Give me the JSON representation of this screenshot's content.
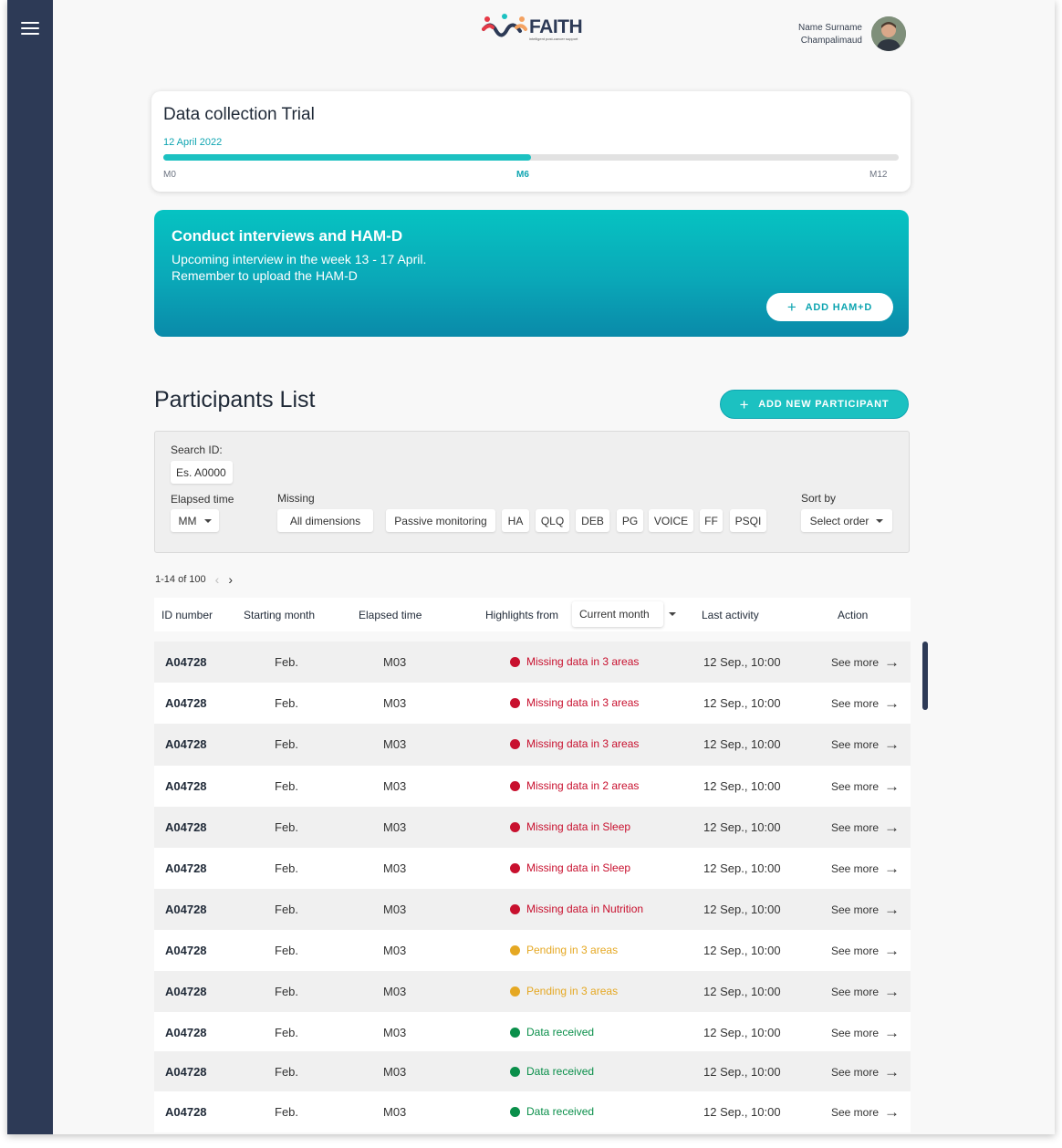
{
  "header": {
    "logo_text": "FAITH",
    "logo_tagline": "intelligent post-cancer support",
    "user_name": "Name Surname",
    "user_org": "Champalimaud"
  },
  "trial": {
    "title": "Data collection Trial",
    "date": "12 April 2022",
    "progress": 0.5,
    "ticks": [
      "M0",
      "M6",
      "M12"
    ],
    "active_tick": "M6"
  },
  "banner": {
    "title": "Conduct interviews and HAM-D",
    "line1": "Upcoming interview in the week 13 - 17 April.",
    "line2": "Remember to upload the HAM-D",
    "button_label": "ADD HAM+D"
  },
  "participants": {
    "title": "Participants List",
    "add_button_label": "ADD NEW PARTICIPANT"
  },
  "filters": {
    "search_label": "Search ID:",
    "search_placeholder": "Es. A0000",
    "elapsed_label": "Elapsed time",
    "elapsed_value": "MM",
    "missing_label": "Missing",
    "missing_all": "All dimensions",
    "dimensions": [
      "Passive monitoring",
      "HA",
      "QLQ",
      "DEB",
      "PG",
      "VOICE",
      "FF",
      "PSQI"
    ],
    "sort_label": "Sort by",
    "sort_value": "Select order"
  },
  "pagination": {
    "range": "1-14 of 100"
  },
  "table": {
    "headers": {
      "id": "ID number",
      "start": "Starting month",
      "elapsed": "Elapsed time",
      "highlights": "Highlights from",
      "highlights_period": "Current month",
      "last": "Last activity",
      "action": "Action"
    },
    "action_label": "See more",
    "rows": [
      {
        "id": "A04728",
        "start": "Feb.",
        "elapsed": "M03",
        "highlight": "Missing data in 3 areas",
        "status": "missing",
        "last": "12 Sep., 10:00"
      },
      {
        "id": "A04728",
        "start": "Feb.",
        "elapsed": "M03",
        "highlight": "Missing data in 3 areas",
        "status": "missing",
        "last": "12 Sep., 10:00"
      },
      {
        "id": "A04728",
        "start": "Feb.",
        "elapsed": "M03",
        "highlight": "Missing data in 3 areas",
        "status": "missing",
        "last": "12 Sep., 10:00"
      },
      {
        "id": "A04728",
        "start": "Feb.",
        "elapsed": "M03",
        "highlight": "Missing data in 2 areas",
        "status": "missing",
        "last": "12 Sep., 10:00"
      },
      {
        "id": "A04728",
        "start": "Feb.",
        "elapsed": "M03",
        "highlight": "Missing data in Sleep",
        "status": "missing",
        "last": "12 Sep., 10:00"
      },
      {
        "id": "A04728",
        "start": "Feb.",
        "elapsed": "M03",
        "highlight": "Missing data in Sleep",
        "status": "missing",
        "last": "12 Sep., 10:00"
      },
      {
        "id": "A04728",
        "start": "Feb.",
        "elapsed": "M03",
        "highlight": "Missing data in Nutrition",
        "status": "missing",
        "last": "12 Sep., 10:00"
      },
      {
        "id": "A04728",
        "start": "Feb.",
        "elapsed": "M03",
        "highlight": "Pending in 3 areas",
        "status": "pending",
        "last": "12 Sep., 10:00"
      },
      {
        "id": "A04728",
        "start": "Feb.",
        "elapsed": "M03",
        "highlight": "Pending in 3 areas",
        "status": "pending",
        "last": "12 Sep., 10:00"
      },
      {
        "id": "A04728",
        "start": "Feb.",
        "elapsed": "M03",
        "highlight": "Data received",
        "status": "received",
        "last": "12 Sep., 10:00"
      },
      {
        "id": "A04728",
        "start": "Feb.",
        "elapsed": "M03",
        "highlight": "Data received",
        "status": "received",
        "last": "12 Sep., 10:00"
      },
      {
        "id": "A04728",
        "start": "Feb.",
        "elapsed": "M03",
        "highlight": "Data received",
        "status": "received",
        "last": "12 Sep., 10:00"
      }
    ]
  },
  "colors": {
    "sidebar": "#2d3a56",
    "accent": "#1cc1c1",
    "missing": "#c8102e",
    "pending": "#e5a823",
    "received": "#0a8f4a"
  }
}
